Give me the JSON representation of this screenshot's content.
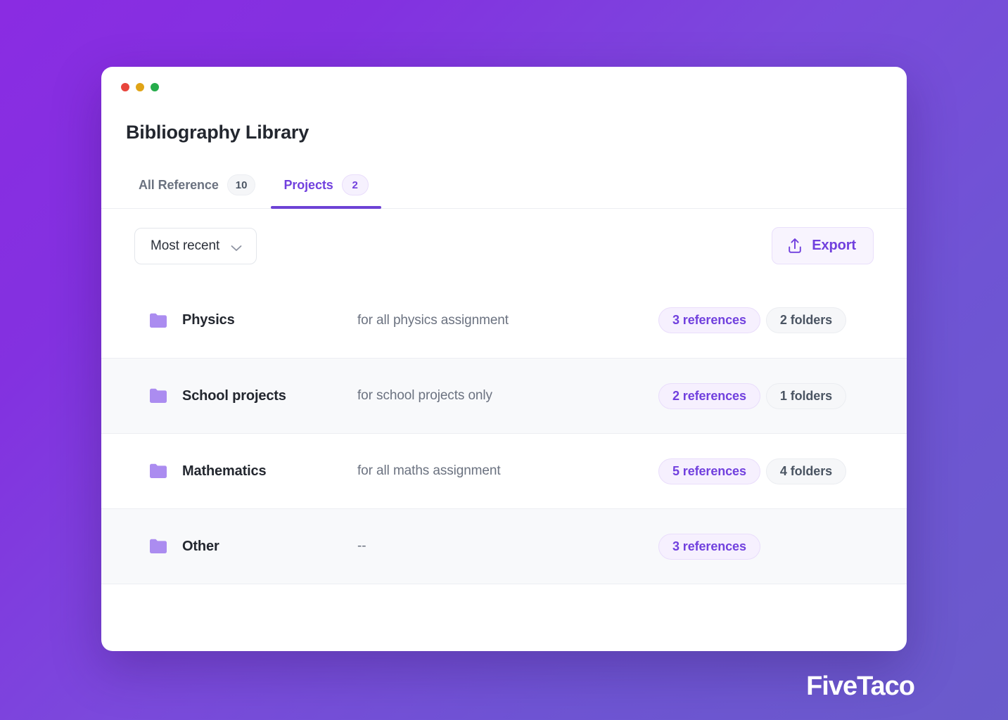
{
  "window": {
    "traffic_lights": [
      {
        "name": "close",
        "color": "#e8453c"
      },
      {
        "name": "minimize",
        "color": "#e0a416"
      },
      {
        "name": "maximize",
        "color": "#26ac4b"
      }
    ],
    "title": "Bibliography Library"
  },
  "tabs": [
    {
      "label": "All Reference",
      "badge": "10",
      "active": false
    },
    {
      "label": "Projects",
      "badge": "2",
      "active": true
    }
  ],
  "toolbar": {
    "sort": {
      "value": "Most recent",
      "icon": "chevron-down-icon"
    },
    "export": {
      "label": "Export",
      "icon": "upload-icon"
    }
  },
  "projects": [
    {
      "icon": "folder-icon",
      "name": "Physics",
      "description": "for all physics assignment",
      "references": "3 references",
      "folders": "2 folders"
    },
    {
      "icon": "folder-icon",
      "name": "School projects",
      "description": "for school projects only",
      "references": "2 references",
      "folders": "1 folders"
    },
    {
      "icon": "folder-icon",
      "name": "Mathematics",
      "description": "for all maths assignment",
      "references": "5 references",
      "folders": "4 folders"
    },
    {
      "icon": "folder-icon",
      "name": "Other",
      "description": "--",
      "references": "3 references",
      "folders": ""
    }
  ],
  "brand": {
    "name": "FiveTaco"
  },
  "colors": {
    "accent": "#7140de",
    "accent_underline": "#6d42d5",
    "folder": "#ab8cf0",
    "bg_gradient_start": "#8a2ce2",
    "bg_gradient_end": "#6a5bcb",
    "row_alt": "#f8f9fb",
    "text_primary": "#23272f",
    "text_muted": "#6b7280"
  }
}
